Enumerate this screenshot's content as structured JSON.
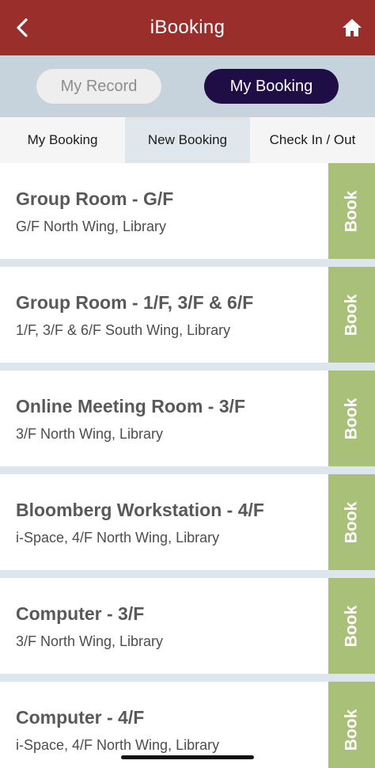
{
  "header": {
    "title": "iBooking",
    "back_icon": "chevron-left-icon",
    "home_icon": "home-icon"
  },
  "segments": {
    "record_label": "My Record",
    "booking_label": "My Booking",
    "selected": "My Booking"
  },
  "tabs": [
    {
      "label": "My Booking"
    },
    {
      "label": "New Booking"
    },
    {
      "label": "Check In / Out"
    }
  ],
  "active_tab": "New Booking",
  "rooms": [
    {
      "name": "Group Room - G/F",
      "location": "G/F North Wing, Library",
      "action": "Book"
    },
    {
      "name": "Group Room - 1/F, 3/F & 6/F",
      "location": "1/F, 3/F & 6/F South Wing, Library",
      "action": "Book"
    },
    {
      "name": "Online Meeting Room - 3/F",
      "location": "3/F North Wing, Library",
      "action": "Book"
    },
    {
      "name": "Bloomberg Workstation - 4/F",
      "location": "i-Space, 4/F North Wing, Library",
      "action": "Book"
    },
    {
      "name": "Computer - 3/F",
      "location": "3/F North Wing, Library",
      "action": "Book"
    },
    {
      "name": "Computer - 4/F",
      "location": "i-Space, 4/F North Wing, Library",
      "action": "Book"
    }
  ],
  "colors": {
    "header": "#9a2e2a",
    "segment_selected": "#1f0d45",
    "book_button": "#a8c077"
  }
}
